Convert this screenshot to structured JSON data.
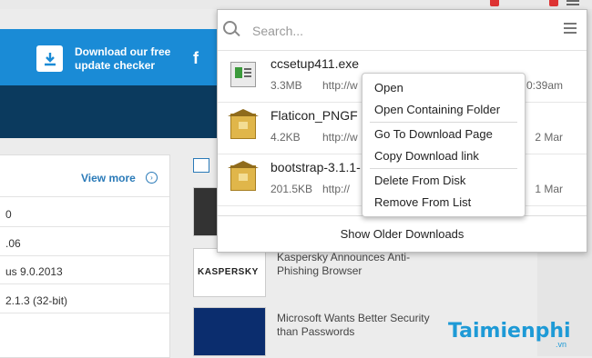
{
  "background_site": {
    "promo_line1": "Download our free",
    "promo_line2": "update checker",
    "facebook_glyph": "f",
    "view_more": "View more",
    "list_items": [
      "0",
      ".06",
      "us 9.0.2013",
      "2.1.3 (32-bit)",
      ""
    ],
    "news": [
      {
        "title": ""
      },
      {
        "title": "Kaspersky Announces Anti-Phishing Browser",
        "logo_text": "KASPERSKY"
      },
      {
        "title": "Microsoft Wants Better Security than Passwords"
      }
    ]
  },
  "watermark": {
    "text": "Taimienphi",
    "suffix": ".vn"
  },
  "downloads_panel": {
    "search_placeholder": "Search...",
    "items": [
      {
        "name": "ccsetup411.exe",
        "size": "3.3MB",
        "url": "http://w",
        "date": "0:39am",
        "icon": "exe-file-icon"
      },
      {
        "name": "Flaticon_PNGF",
        "size": "4.2KB",
        "url": "http://w",
        "date": "2 Mar",
        "icon": "zip-archive-icon"
      },
      {
        "name": "bootstrap-3.1.1-",
        "size": "201.5KB",
        "url": "http://",
        "date": "1 Mar",
        "icon": "zip-archive-icon"
      }
    ],
    "show_older": "Show Older Downloads"
  },
  "context_menu": {
    "open": "Open",
    "open_folder": "Open Containing Folder",
    "go_to_page": "Go To Download Page",
    "copy_link": "Copy Download link",
    "delete": "Delete From Disk",
    "remove": "Remove From List"
  },
  "colors": {
    "blue_banner": "#1a8bd6",
    "dark_banner": "#0b3a5e",
    "watermark": "#1e9ad6"
  }
}
